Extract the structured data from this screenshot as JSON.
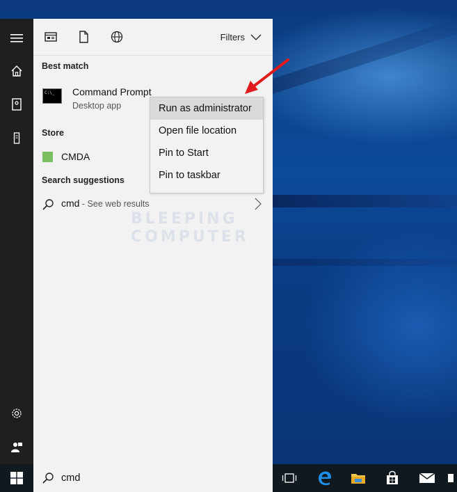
{
  "panel": {
    "filters_label": "Filters",
    "best_match_heading": "Best match",
    "best_match": {
      "title": "Command Prompt",
      "subtitle": "Desktop app"
    },
    "store_heading": "Store",
    "store_item": "CMDA",
    "suggestions_heading": "Search suggestions",
    "suggestion": {
      "query": "cmd",
      "suffix": " - See web results"
    }
  },
  "context_menu": {
    "items": [
      "Run as administrator",
      "Open file location",
      "Pin to Start",
      "Pin to taskbar"
    ]
  },
  "search": {
    "value": "cmd"
  },
  "watermark": {
    "line1": "BLEEPING",
    "line2": "COMPUTER"
  },
  "colors": {
    "rail": "#1f1f1f",
    "panel": "#f2f2f2",
    "taskbar": "#101820",
    "arrow": "#e01b1b",
    "highlight": "#dadada"
  }
}
